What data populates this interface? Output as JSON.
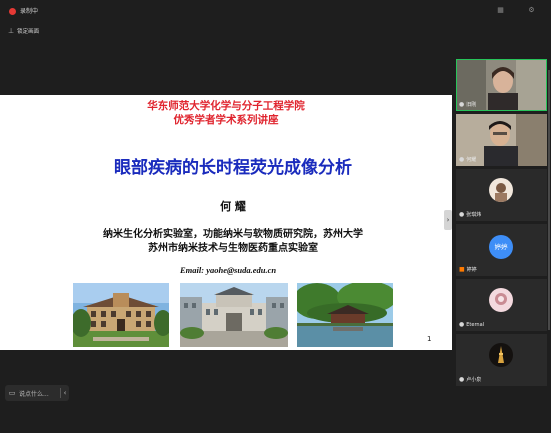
{
  "top_bar": {
    "record_label": "录制中",
    "pin_label": "锁定画面"
  },
  "slide": {
    "org_line1": "华东师范大学化学与分子工程学院",
    "org_line2": "优秀学者学术系列讲座",
    "title": "眼部疾病的长时程荧光成像分析",
    "speaker": "何  耀",
    "affiliation1": "纳米生化分析实验室，功能纳米与软物质研究院，苏州大学",
    "affiliation2": "苏州市纳米技术与生物医药重点实验室",
    "email": "Email: yaohe@suda.edu.cn",
    "page_number": "1",
    "colors": {
      "org": "#e0242e",
      "title": "#1a2bbd"
    }
  },
  "chat": {
    "placeholder": "说点什么..."
  },
  "participants": [
    {
      "name": "旧刚",
      "mic": "on",
      "video": true
    },
    {
      "name": "何耀",
      "mic": "on",
      "video": true
    },
    {
      "name": "张琪炜",
      "mic": "on",
      "video": false
    },
    {
      "name": "婷婷",
      "mic": "off",
      "video": false,
      "avatar_text": "婷婷"
    },
    {
      "name": "Eternal",
      "mic": "on",
      "video": false
    },
    {
      "name": "卢小泉",
      "mic": "on",
      "video": false
    }
  ],
  "icons": {
    "record": "record-dot-icon",
    "pin": "pin-icon",
    "chat": "chat-icon",
    "mic": "microphone-icon",
    "expand": "chevron-right-icon"
  }
}
